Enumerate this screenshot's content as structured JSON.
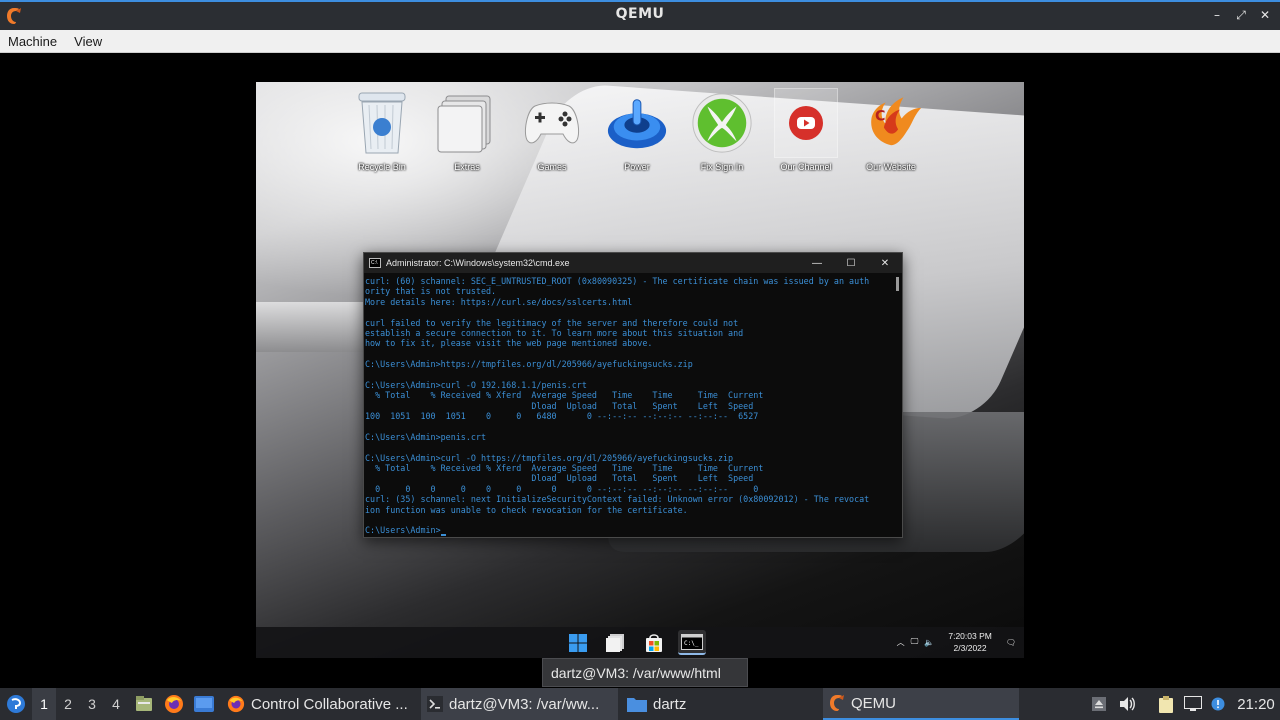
{
  "window": {
    "title": "QEMU",
    "controls": [
      "–",
      "⤢",
      "✕"
    ]
  },
  "menubar": {
    "items": [
      "Machine",
      "View"
    ]
  },
  "guest": {
    "desktop_icons": [
      {
        "label": "Recycle Bin",
        "icon": "recycle-bin-icon"
      },
      {
        "label": "Extras",
        "icon": "folder-icon"
      },
      {
        "label": "Games",
        "icon": "gamepad-icon"
      },
      {
        "label": "Power",
        "icon": "power-icon"
      },
      {
        "label": "Fix Sign In",
        "icon": "xbox-icon"
      },
      {
        "label": "Our Channel",
        "icon": "youtube-icon"
      },
      {
        "label": "Our Website",
        "icon": "phoenix-logo-icon"
      }
    ],
    "cmd": {
      "title": "Administrator: C:\\Windows\\system32\\cmd.exe",
      "lines": [
        "curl: (60) schannel: SEC_E_UNTRUSTED_ROOT (0x80090325) - The certificate chain was issued by an auth",
        "ority that is not trusted.",
        "More details here: https://curl.se/docs/sslcerts.html",
        "",
        "curl failed to verify the legitimacy of the server and therefore could not",
        "establish a secure connection to it. To learn more about this situation and",
        "how to fix it, please visit the web page mentioned above.",
        "",
        "C:\\Users\\Admin>https://tmpfiles.org/dl/205966/ayefuckingsucks.zip",
        "",
        "C:\\Users\\Admin>curl -O 192.168.1.1/penis.crt",
        "  % Total    % Received % Xferd  Average Speed   Time    Time     Time  Current",
        "                                 Dload  Upload   Total   Spent    Left  Speed",
        "100  1051  100  1051    0     0   6480      0 --:--:-- --:--:-- --:--:--  6527",
        "",
        "C:\\Users\\Admin>penis.crt",
        "",
        "C:\\Users\\Admin>curl -O https://tmpfiles.org/dl/205966/ayefuckingsucks.zip",
        "  % Total    % Received % Xferd  Average Speed   Time    Time     Time  Current",
        "                                 Dload  Upload   Total   Spent    Left  Speed",
        "  0     0    0     0    0     0      0      0 --:--:-- --:--:-- --:--:--     0",
        "curl: (35) schannel: next InitializeSecurityContext failed: Unknown error (0x80092012) - The revocat",
        "ion function was unable to check revocation for the certificate.",
        "",
        "C:\\Users\\Admin>"
      ]
    },
    "taskbar": {
      "apps": [
        "windows-start-icon",
        "file-explorer-icon",
        "store-icon",
        "cmd-icon"
      ],
      "time": "7:20:03 PM",
      "date": "2/3/2022"
    }
  },
  "tooltip": "dartz@VM3: /var/www/html",
  "host_panel": {
    "workspaces": [
      "1",
      "2",
      "3",
      "4"
    ],
    "active_workspace": "1",
    "tasks": [
      {
        "label": "Control Collaborative ...",
        "icon": "firefox-icon"
      },
      {
        "label": "dartz@VM3: /var/ww...",
        "icon": "terminal-icon"
      },
      {
        "label": "dartz",
        "icon": "folder-icon"
      },
      {
        "label": "QEMU",
        "icon": "qemu-icon"
      }
    ],
    "clock": "21:20",
    "accent": "#3d8ee0"
  }
}
